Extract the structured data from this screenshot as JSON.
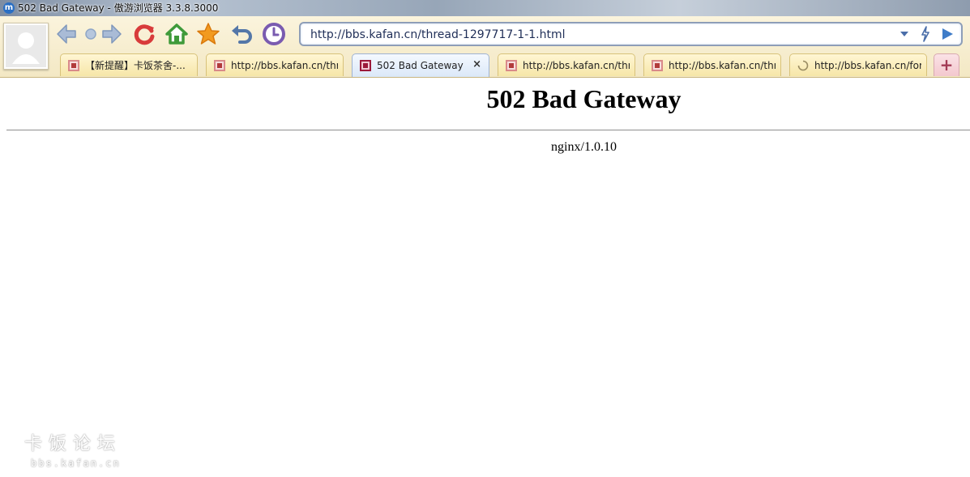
{
  "window": {
    "title": "502 Bad Gateway - 傲游浏览器 3.3.8.3000",
    "app_icon": "maxthon-m-icon"
  },
  "toolbar": {
    "buttons": [
      {
        "name": "back-button",
        "icon": "back-arrow-icon"
      },
      {
        "name": "stop-button",
        "icon": "dot-icon"
      },
      {
        "name": "forward-button",
        "icon": "forward-arrow-icon"
      },
      {
        "name": "refresh-button",
        "icon": "refresh-icon"
      },
      {
        "name": "home-button",
        "icon": "home-icon"
      },
      {
        "name": "favorites-button",
        "icon": "star-icon"
      },
      {
        "name": "undo-close-button",
        "icon": "undo-icon"
      },
      {
        "name": "history-button",
        "icon": "clock-icon"
      }
    ],
    "colors": {
      "back": "#8fa6c6",
      "refresh": "#d83b3b",
      "home": "#3f9a3a",
      "star": "#f29a1f",
      "undo": "#5477a8",
      "clock": "#7a5bb0"
    }
  },
  "address_bar": {
    "value": "http://bbs.kafan.cn/thread-1297717-1-1.html"
  },
  "tabs": [
    {
      "label": "【新提醒】卡饭茶舍-...",
      "favicon": "kafan-icon",
      "active": false
    },
    {
      "label": "http://bbs.kafan.cn/thr...",
      "favicon": "kafan-icon",
      "active": false
    },
    {
      "label": "502 Bad Gateway",
      "favicon": "kafan-icon",
      "active": true,
      "close": "×"
    },
    {
      "label": "http://bbs.kafan.cn/thr...",
      "favicon": "kafan-icon",
      "active": false
    },
    {
      "label": "http://bbs.kafan.cn/thr...",
      "favicon": "kafan-icon",
      "active": false
    },
    {
      "label": "http://bbs.kafan.cn/for...",
      "favicon": "loading-spinner-icon",
      "active": false
    }
  ],
  "new_tab": {
    "label": "+"
  },
  "page": {
    "heading": "502 Bad Gateway",
    "server": "nginx/1.0.10"
  },
  "watermark": {
    "text_cn": "卡饭论坛",
    "text_en": "bbs.kafan.cn"
  }
}
